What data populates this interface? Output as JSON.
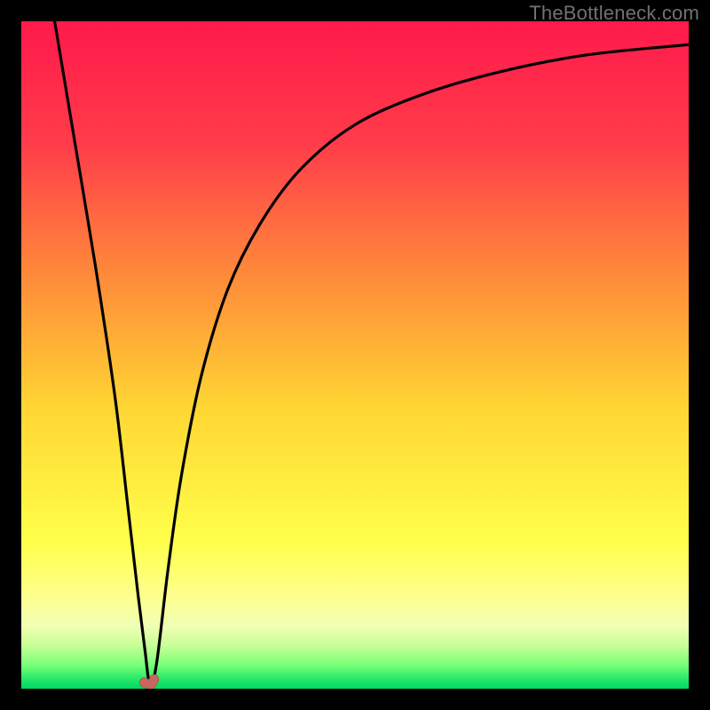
{
  "watermark": "TheBottleneck.com",
  "chart_data": {
    "type": "line",
    "title": "",
    "xlabel": "",
    "ylabel": "",
    "xlim": [
      0,
      100
    ],
    "ylim": [
      0,
      100
    ],
    "gradient_stops": [
      {
        "pos": 0.0,
        "color": "#ff1a4b"
      },
      {
        "pos": 0.18,
        "color": "#ff3b4a"
      },
      {
        "pos": 0.38,
        "color": "#ff8a3a"
      },
      {
        "pos": 0.58,
        "color": "#ffd633"
      },
      {
        "pos": 0.78,
        "color": "#ffff4a"
      },
      {
        "pos": 0.86,
        "color": "#fdff8c"
      },
      {
        "pos": 0.905,
        "color": "#f2ffb4"
      },
      {
        "pos": 0.935,
        "color": "#c8ff98"
      },
      {
        "pos": 0.965,
        "color": "#78ff78"
      },
      {
        "pos": 0.985,
        "color": "#28e86a"
      },
      {
        "pos": 1.0,
        "color": "#00d860"
      }
    ],
    "series": [
      {
        "name": "bottleneck-curve",
        "x": [
          5,
          8,
          11,
          14,
          16,
          17.5,
          18.5,
          19.3,
          20.3,
          22,
          24,
          27,
          31,
          36,
          42,
          50,
          60,
          72,
          85,
          100
        ],
        "y": [
          100,
          82,
          64,
          44,
          27,
          14,
          6,
          0.5,
          4,
          18,
          32,
          47,
          60,
          70,
          78,
          84.5,
          89,
          92.5,
          95,
          96.5
        ]
      }
    ],
    "marker": {
      "x": 19.3,
      "y": 0.5,
      "name": "optimal-point",
      "color": "#c86a5f"
    }
  }
}
